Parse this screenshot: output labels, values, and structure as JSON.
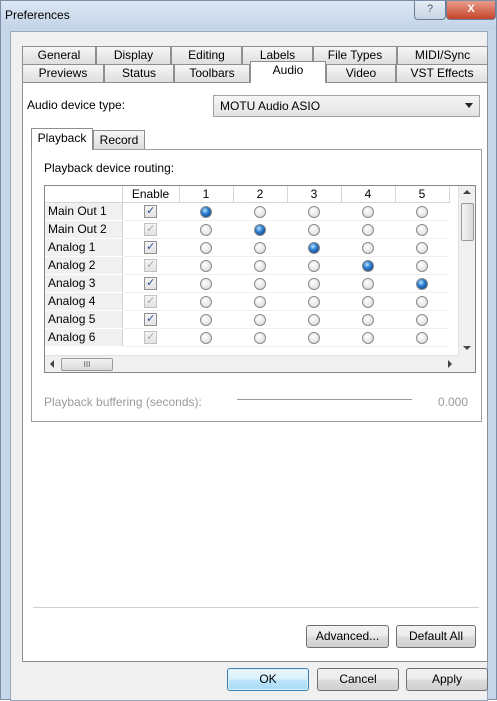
{
  "window": {
    "title": "Preferences",
    "help_label": "?",
    "close_label": "X"
  },
  "tabs_row1": [
    "General",
    "Display",
    "Editing",
    "Labels",
    "File Types",
    "MIDI/Sync"
  ],
  "tabs_row2": [
    "Previews",
    "Status",
    "Toolbars",
    "Audio",
    "Video",
    "VST Effects"
  ],
  "active_tab": "Audio",
  "audio": {
    "device_type_label": "Audio device type:",
    "device_type_value": "MOTU Audio ASIO",
    "subtabs": [
      "Playback",
      "Record"
    ],
    "active_subtab": "Playback",
    "routing_label": "Playback device routing:",
    "columns": [
      "Enable",
      "1",
      "2",
      "3",
      "4",
      "5"
    ],
    "rows": [
      {
        "label": "Main Out 1",
        "enabled": "checked",
        "selected_output": 1
      },
      {
        "label": "Main Out 2",
        "enabled": "checked-disabled",
        "selected_output": 2
      },
      {
        "label": "Analog 1",
        "enabled": "checked",
        "selected_output": 3
      },
      {
        "label": "Analog 2",
        "enabled": "checked-disabled",
        "selected_output": 4
      },
      {
        "label": "Analog 3",
        "enabled": "checked",
        "selected_output": 5
      },
      {
        "label": "Analog 4",
        "enabled": "checked-disabled",
        "selected_output": 0
      },
      {
        "label": "Analog 5",
        "enabled": "checked",
        "selected_output": 0
      },
      {
        "label": "Analog 6",
        "enabled": "checked-disabled",
        "selected_output": 0
      }
    ],
    "hscroll_thumb": "III",
    "buffering_label": "Playback buffering (seconds):",
    "buffering_value": "0.000"
  },
  "buttons": {
    "advanced": "Advanced...",
    "default_all": "Default All",
    "ok": "OK",
    "cancel": "Cancel",
    "apply": "Apply"
  }
}
